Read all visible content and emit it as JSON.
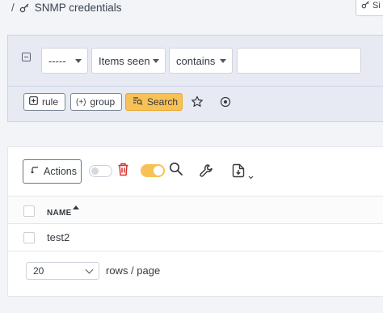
{
  "breadcrumb": {
    "separator": "/",
    "title": "SNMP credentials"
  },
  "top_button": {
    "label": "Si"
  },
  "filter": {
    "field1": "-----",
    "field2": "Items seen",
    "operator": "contains",
    "value": "",
    "rule_label": "rule",
    "group_label": "group",
    "search_label": "Search"
  },
  "toolbar": {
    "actions_label": "Actions"
  },
  "table": {
    "columns": [
      "NAME"
    ],
    "rows": [
      {
        "name": "test2"
      }
    ]
  },
  "pagination": {
    "page_size": "20",
    "rows_label": "rows / page"
  },
  "colors": {
    "accent": "#f8c155",
    "danger": "#d9302c"
  }
}
